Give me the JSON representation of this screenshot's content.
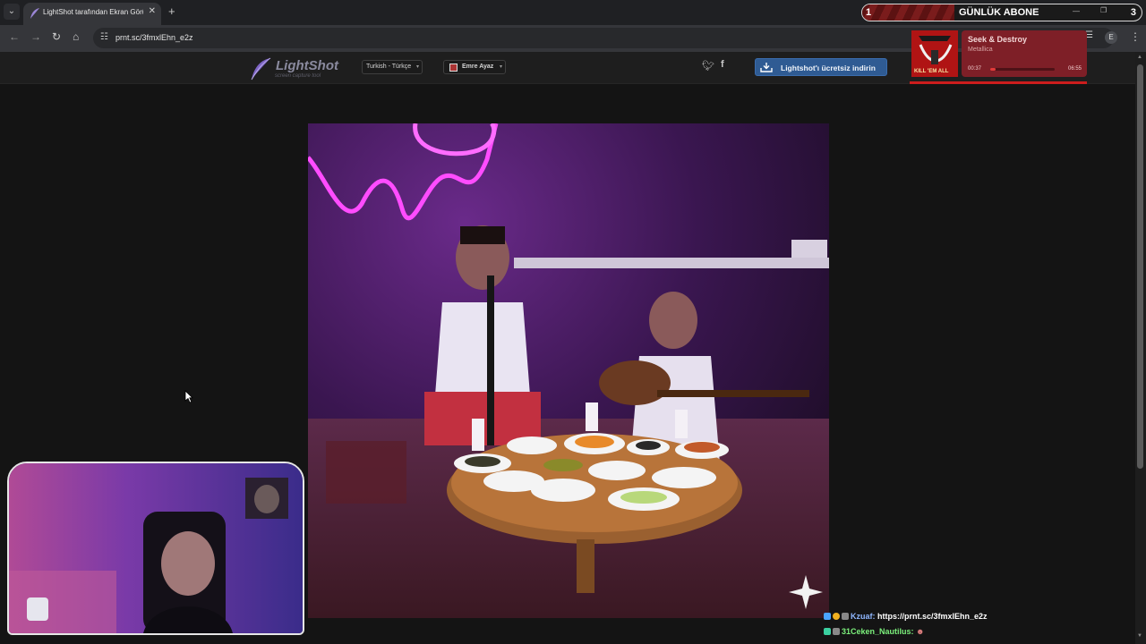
{
  "browser": {
    "tab_title": "LightShot tarafından Ekran Görüntüsü",
    "tab_close": "✕",
    "new_tab": "+",
    "url": "prnt.sc/3fmxlEhn_e2z",
    "profile_initial": "E"
  },
  "lightshot": {
    "logo_title": "LightShot",
    "logo_subtitle": "screen capture tool",
    "language": "Turkish - Türkçe",
    "user": "Emre Ayaz",
    "download_button": "Lightshot'ı ücretsiz indirin",
    "colors": {
      "header": "#1e1e1e",
      "download": "#2f5b93"
    }
  },
  "overlay": {
    "sub_counter_left": "1",
    "sub_title": "GÜNLÜK ABONE",
    "sub_counter_right": "3",
    "sub_progress": 0.33,
    "music": {
      "album_text": "KILL 'EM ALL",
      "song": "Seek & Destroy",
      "artist": "Metallica",
      "time_current": "00:37",
      "time_total": "06:55",
      "progress": 0.09
    },
    "chat": [
      {
        "user": "Kzuaf:",
        "message": "https://prnt.sc/3fmxlEhn_e2z"
      },
      {
        "user": "31Ceken_Nautilus:",
        "message": ""
      }
    ]
  }
}
